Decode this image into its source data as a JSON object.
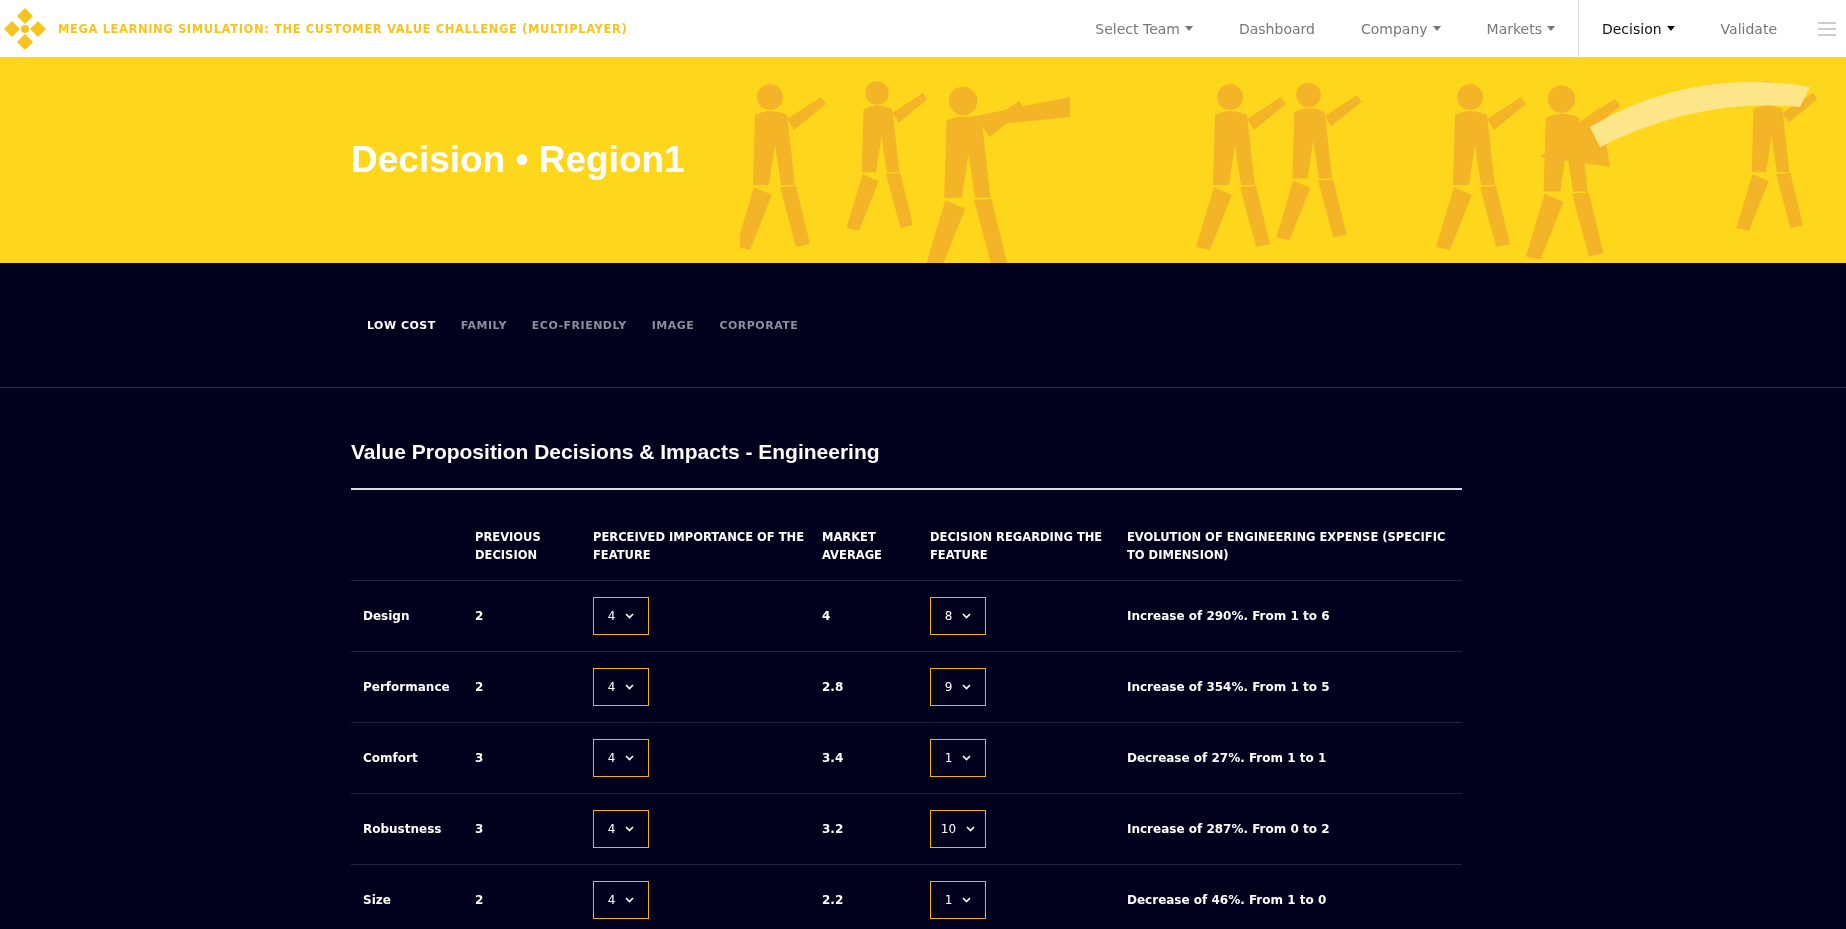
{
  "brand": {
    "title": "MEGA LEARNING SIMULATION: THE CUSTOMER VALUE CHALLENGE (MULTIPLAYER)"
  },
  "nav": [
    {
      "label": "Select Team",
      "dropdown": true,
      "selected": false
    },
    {
      "label": "Dashboard",
      "dropdown": false,
      "selected": false
    },
    {
      "label": "Company",
      "dropdown": true,
      "selected": false
    },
    {
      "label": "Markets",
      "dropdown": true,
      "selected": false
    },
    {
      "label": "Decision",
      "dropdown": true,
      "selected": true
    },
    {
      "label": "Validate",
      "dropdown": false,
      "selected": false
    }
  ],
  "page_title": "Decision • Region1",
  "tabs": [
    {
      "label": "LOW COST",
      "selected": true
    },
    {
      "label": "FAMILY",
      "selected": false
    },
    {
      "label": "ECO-FRIENDLY",
      "selected": false
    },
    {
      "label": "IMAGE",
      "selected": false
    },
    {
      "label": "CORPORATE",
      "selected": false
    }
  ],
  "section_title": "Value Proposition Decisions & Impacts - Engineering",
  "table": {
    "columns": [
      "",
      "PREVIOUS DECISION",
      "PERCEIVED IMPORTANCE OF THE FEATURE",
      "MARKET AVERAGE",
      "DECISION REGARDING THE FEATURE",
      "EVOLUTION OF ENGINEERING EXPENSE (SPECIFIC TO DIMENSION)"
    ],
    "rows": [
      {
        "feature": "Design",
        "previous": "2",
        "importance": "4",
        "market_average": "4",
        "decision": "8",
        "evolution": "Increase of 290%. From 1 to 6"
      },
      {
        "feature": "Performance",
        "previous": "2",
        "importance": "4",
        "market_average": "2.8",
        "decision": "9",
        "evolution": "Increase of 354%. From 1 to 5"
      },
      {
        "feature": "Comfort",
        "previous": "3",
        "importance": "4",
        "market_average": "3.4",
        "decision": "1",
        "evolution": "Decrease of 27%. From 1 to 1"
      },
      {
        "feature": "Robustness",
        "previous": "3",
        "importance": "4",
        "market_average": "3.2",
        "decision": "10",
        "evolution": "Increase of 287%. From 0 to 2"
      },
      {
        "feature": "Size",
        "previous": "2",
        "importance": "4",
        "market_average": "2.2",
        "decision": "1",
        "evolution": "Decrease of 46%. From 1 to 0"
      }
    ]
  }
}
